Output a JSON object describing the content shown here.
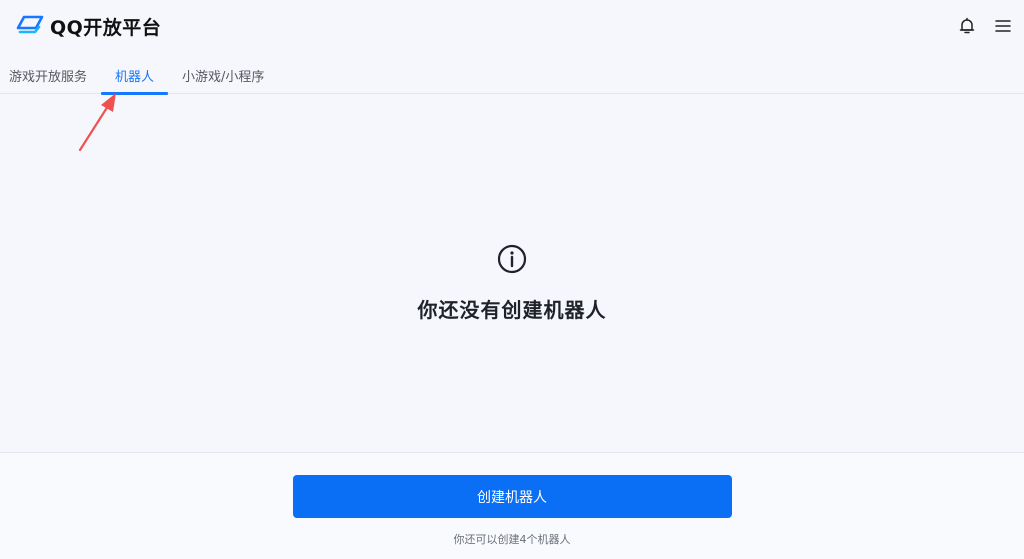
{
  "header": {
    "logo_text": "QQ开放平台",
    "logo_icon": "qq-platform-logo",
    "bell_icon": "bell-icon",
    "menu_icon": "menu-icon"
  },
  "tabs": [
    {
      "label": "游戏开放服务",
      "active": false
    },
    {
      "label": "机器人",
      "active": true
    },
    {
      "label": "小游戏/小程序",
      "active": false
    }
  ],
  "annotation": {
    "icon": "red-arrow",
    "color": "#f05050"
  },
  "empty_state": {
    "icon": "info-icon",
    "title": "你还没有创建机器人"
  },
  "footer": {
    "create_button_label": "创建机器人",
    "quota_text": "你还可以创建4个机器人"
  },
  "colors": {
    "accent": "#1677ff",
    "button": "#0b6ff5",
    "background": "#f6f7fc"
  }
}
